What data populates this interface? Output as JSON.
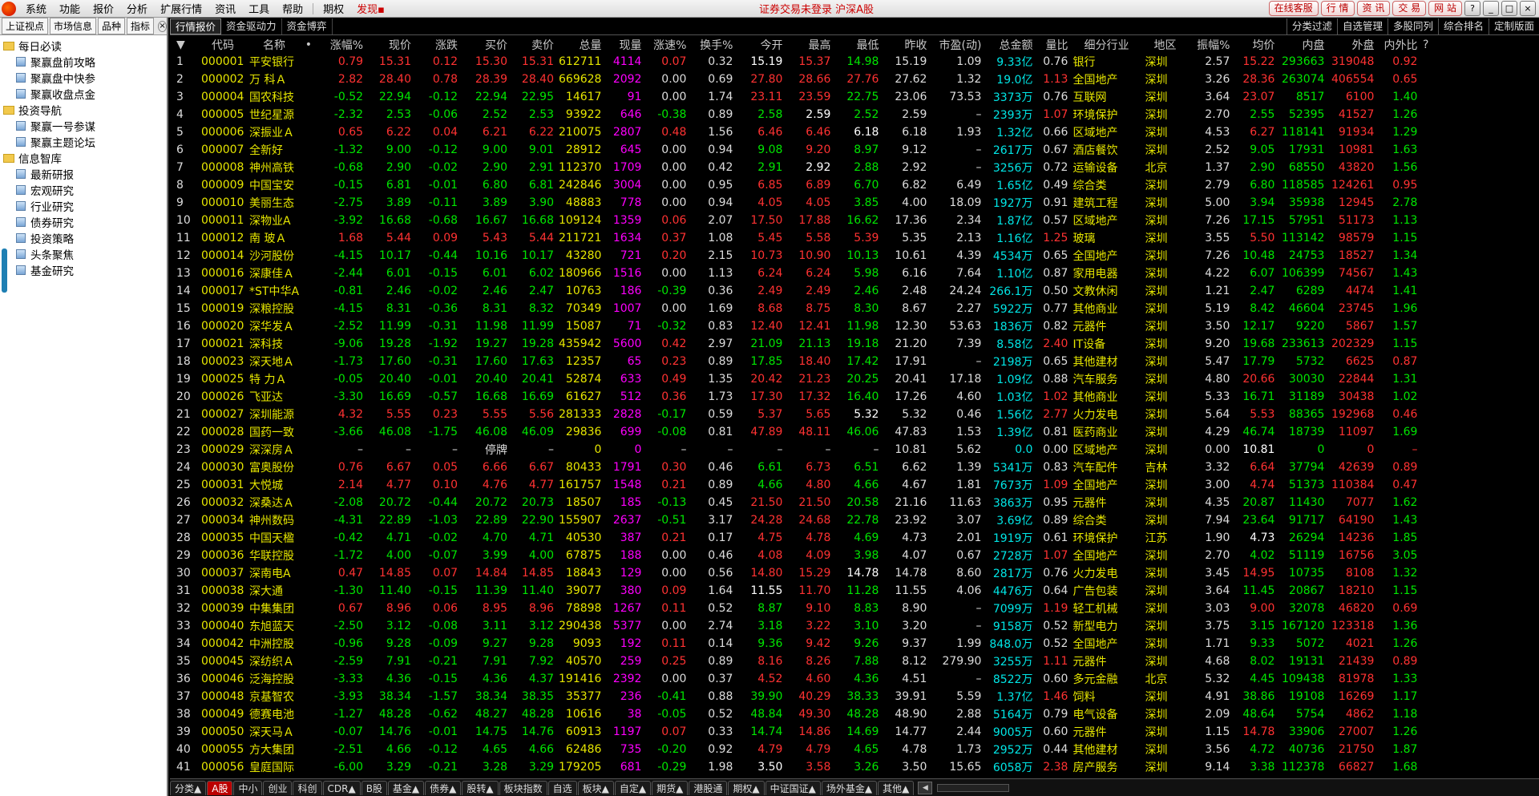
{
  "menubar": {
    "items": [
      "系统",
      "功能",
      "报价",
      "分析",
      "扩展行情",
      "资讯",
      "工具",
      "帮助"
    ],
    "extra_items": [
      "期权",
      "发现"
    ],
    "center_text": "证券交易未登录  沪深A股",
    "right_buttons": [
      "在线客服",
      "行 情",
      "资 讯",
      "交 易",
      "网 站"
    ],
    "window_buttons": [
      "?",
      "_",
      "□",
      "×"
    ]
  },
  "sidebar": {
    "tabs": [
      "上证视点",
      "市场信息",
      "品种",
      "指标"
    ],
    "close": "×",
    "tree": [
      {
        "label": "每日必读",
        "children": [
          "聚赢盘前攻略",
          "聚赢盘中快参",
          "聚赢收盘点金"
        ]
      },
      {
        "label": "投资导航",
        "children": [
          "聚赢一号参谋",
          "聚赢主题论坛"
        ]
      },
      {
        "label": "信息智库",
        "children": [
          "最新研报",
          "宏观研究",
          "行业研究",
          "债券研究",
          "投资策略",
          "头条聚焦",
          "基金研究"
        ]
      }
    ]
  },
  "toptabs": {
    "left": [
      "行情报价",
      "资金驱动力",
      "资金博弈"
    ],
    "right": [
      "分类过滤",
      "自选管理",
      "多股同列",
      "综合排名",
      "定制版面"
    ]
  },
  "table": {
    "headers": [
      "",
      "代码",
      "名称",
      "",
      "涨幅%",
      "现价",
      "涨跌",
      "买价",
      "卖价",
      "总量",
      "现量",
      "涨速%",
      "换手%",
      "今开",
      "最高",
      "最低",
      "昨收",
      "市盈(动)",
      "总金额",
      "量比",
      "细分行业",
      "地区",
      "振幅%",
      "均价",
      "内盘",
      "外盘",
      "内外比",
      "?"
    ],
    "rows": [
      [
        "1",
        "000001",
        "平安银行",
        "0.79",
        "15.31",
        "0.12",
        "15.30",
        "15.31",
        "612711",
        "4114",
        "0.07",
        "0.32",
        "15.19",
        "15.37",
        "14.98",
        "15.19",
        "1.09",
        "9.33亿",
        "0.76",
        "银行",
        "深圳",
        "2.57",
        "15.22",
        "293663",
        "319048",
        "0.92"
      ],
      [
        "2",
        "000002",
        "万 科Ａ",
        "2.82",
        "28.40",
        "0.78",
        "28.39",
        "28.40",
        "669628",
        "2092",
        "0.00",
        "0.69",
        "27.80",
        "28.66",
        "27.76",
        "27.62",
        "1.32",
        "19.0亿",
        "1.13",
        "全国地产",
        "深圳",
        "3.26",
        "28.36",
        "263074",
        "406554",
        "0.65"
      ],
      [
        "3",
        "000004",
        "国农科技",
        "-0.52",
        "22.94",
        "-0.12",
        "22.94",
        "22.95",
        "14617",
        "91",
        "0.00",
        "1.74",
        "23.11",
        "23.59",
        "22.75",
        "23.06",
        "73.53",
        "3373万",
        "0.76",
        "互联网",
        "深圳",
        "3.64",
        "23.07",
        "8517",
        "6100",
        "1.40"
      ],
      [
        "4",
        "000005",
        "世纪星源",
        "-2.32",
        "2.53",
        "-0.06",
        "2.52",
        "2.53",
        "93922",
        "646",
        "-0.38",
        "0.89",
        "2.58",
        "2.59",
        "2.52",
        "2.59",
        "–",
        "2393万",
        "1.07",
        "环境保护",
        "深圳",
        "2.70",
        "2.55",
        "52395",
        "41527",
        "1.26"
      ],
      [
        "5",
        "000006",
        "深振业Ａ",
        "0.65",
        "6.22",
        "0.04",
        "6.21",
        "6.22",
        "210075",
        "2807",
        "0.48",
        "1.56",
        "6.46",
        "6.46",
        "6.18",
        "6.18",
        "1.93",
        "1.32亿",
        "0.66",
        "区域地产",
        "深圳",
        "4.53",
        "6.27",
        "118141",
        "91934",
        "1.29"
      ],
      [
        "6",
        "000007",
        "全新好",
        "-1.32",
        "9.00",
        "-0.12",
        "9.00",
        "9.01",
        "28912",
        "645",
        "0.00",
        "0.94",
        "9.08",
        "9.20",
        "8.97",
        "9.12",
        "–",
        "2617万",
        "0.67",
        "酒店餐饮",
        "深圳",
        "2.52",
        "9.05",
        "17931",
        "10981",
        "1.63"
      ],
      [
        "7",
        "000008",
        "神州高铁",
        "-0.68",
        "2.90",
        "-0.02",
        "2.90",
        "2.91",
        "112370",
        "1709",
        "0.00",
        "0.42",
        "2.91",
        "2.92",
        "2.88",
        "2.92",
        "–",
        "3256万",
        "0.72",
        "运输设备",
        "北京",
        "1.37",
        "2.90",
        "68550",
        "43820",
        "1.56"
      ],
      [
        "8",
        "000009",
        "中国宝安",
        "-0.15",
        "6.81",
        "-0.01",
        "6.80",
        "6.81",
        "242846",
        "3004",
        "0.00",
        "0.95",
        "6.85",
        "6.89",
        "6.70",
        "6.82",
        "6.49",
        "1.65亿",
        "0.49",
        "综合类",
        "深圳",
        "2.79",
        "6.80",
        "118585",
        "124261",
        "0.95"
      ],
      [
        "9",
        "000010",
        "美丽生态",
        "-2.75",
        "3.89",
        "-0.11",
        "3.89",
        "3.90",
        "48883",
        "778",
        "0.00",
        "0.94",
        "4.05",
        "4.05",
        "3.85",
        "4.00",
        "18.09",
        "1927万",
        "0.91",
        "建筑工程",
        "深圳",
        "5.00",
        "3.94",
        "35938",
        "12945",
        "2.78"
      ],
      [
        "10",
        "000011",
        "深物业A",
        "-3.92",
        "16.68",
        "-0.68",
        "16.67",
        "16.68",
        "109124",
        "1359",
        "0.06",
        "2.07",
        "17.50",
        "17.88",
        "16.62",
        "17.36",
        "2.34",
        "1.87亿",
        "0.57",
        "区域地产",
        "深圳",
        "7.26",
        "17.15",
        "57951",
        "51173",
        "1.13"
      ],
      [
        "11",
        "000012",
        "南 玻Ａ",
        "1.68",
        "5.44",
        "0.09",
        "5.43",
        "5.44",
        "211721",
        "1634",
        "0.37",
        "1.08",
        "5.45",
        "5.58",
        "5.39",
        "5.35",
        "2.13",
        "1.16亿",
        "1.25",
        "玻璃",
        "深圳",
        "3.55",
        "5.50",
        "113142",
        "98579",
        "1.15"
      ],
      [
        "12",
        "000014",
        "沙河股份",
        "-4.15",
        "10.17",
        "-0.44",
        "10.16",
        "10.17",
        "43280",
        "721",
        "0.20",
        "2.15",
        "10.73",
        "10.90",
        "10.13",
        "10.61",
        "4.39",
        "4534万",
        "0.65",
        "全国地产",
        "深圳",
        "7.26",
        "10.48",
        "24753",
        "18527",
        "1.34"
      ],
      [
        "13",
        "000016",
        "深康佳Ａ",
        "-2.44",
        "6.01",
        "-0.15",
        "6.01",
        "6.02",
        "180966",
        "1516",
        "0.00",
        "1.13",
        "6.24",
        "6.24",
        "5.98",
        "6.16",
        "7.64",
        "1.10亿",
        "0.87",
        "家用电器",
        "深圳",
        "4.22",
        "6.07",
        "106399",
        "74567",
        "1.43"
      ],
      [
        "14",
        "000017",
        "*ST中华A",
        "-0.81",
        "2.46",
        "-0.02",
        "2.46",
        "2.47",
        "10763",
        "186",
        "-0.39",
        "0.36",
        "2.49",
        "2.49",
        "2.46",
        "2.48",
        "24.24",
        "266.1万",
        "0.50",
        "文教休闲",
        "深圳",
        "1.21",
        "2.47",
        "6289",
        "4474",
        "1.41"
      ],
      [
        "15",
        "000019",
        "深粮控股",
        "-4.15",
        "8.31",
        "-0.36",
        "8.31",
        "8.32",
        "70349",
        "1007",
        "0.00",
        "1.69",
        "8.68",
        "8.75",
        "8.30",
        "8.67",
        "2.27",
        "5922万",
        "0.77",
        "其他商业",
        "深圳",
        "5.19",
        "8.42",
        "46604",
        "23745",
        "1.96"
      ],
      [
        "16",
        "000020",
        "深华发Ａ",
        "-2.52",
        "11.99",
        "-0.31",
        "11.98",
        "11.99",
        "15087",
        "71",
        "-0.32",
        "0.83",
        "12.40",
        "12.41",
        "11.98",
        "12.30",
        "53.63",
        "1836万",
        "0.82",
        "元器件",
        "深圳",
        "3.50",
        "12.17",
        "9220",
        "5867",
        "1.57"
      ],
      [
        "17",
        "000021",
        "深科技",
        "-9.06",
        "19.28",
        "-1.92",
        "19.27",
        "19.28",
        "435942",
        "5600",
        "0.42",
        "2.97",
        "21.09",
        "21.13",
        "19.18",
        "21.20",
        "7.39",
        "8.58亿",
        "2.40",
        "IT设备",
        "深圳",
        "9.20",
        "19.68",
        "233613",
        "202329",
        "1.15"
      ],
      [
        "18",
        "000023",
        "深天地Ａ",
        "-1.73",
        "17.60",
        "-0.31",
        "17.60",
        "17.63",
        "12357",
        "65",
        "0.23",
        "0.89",
        "17.85",
        "18.40",
        "17.42",
        "17.91",
        "–",
        "2198万",
        "0.65",
        "其他建材",
        "深圳",
        "5.47",
        "17.79",
        "5732",
        "6625",
        "0.87"
      ],
      [
        "19",
        "000025",
        "特 力Ａ",
        "-0.05",
        "20.40",
        "-0.01",
        "20.40",
        "20.41",
        "52874",
        "633",
        "0.49",
        "1.35",
        "20.42",
        "21.23",
        "20.25",
        "20.41",
        "17.18",
        "1.09亿",
        "0.88",
        "汽车服务",
        "深圳",
        "4.80",
        "20.66",
        "30030",
        "22844",
        "1.31"
      ],
      [
        "20",
        "000026",
        "飞亚达",
        "-3.30",
        "16.69",
        "-0.57",
        "16.68",
        "16.69",
        "61627",
        "512",
        "0.36",
        "1.73",
        "17.30",
        "17.32",
        "16.40",
        "17.26",
        "4.60",
        "1.03亿",
        "1.02",
        "其他商业",
        "深圳",
        "5.33",
        "16.71",
        "31189",
        "30438",
        "1.02"
      ],
      [
        "21",
        "000027",
        "深圳能源",
        "4.32",
        "5.55",
        "0.23",
        "5.55",
        "5.56",
        "281333",
        "2828",
        "-0.17",
        "0.59",
        "5.37",
        "5.65",
        "5.32",
        "5.32",
        "0.46",
        "1.56亿",
        "2.77",
        "火力发电",
        "深圳",
        "5.64",
        "5.53",
        "88365",
        "192968",
        "0.46"
      ],
      [
        "22",
        "000028",
        "国药一致",
        "-3.66",
        "46.08",
        "-1.75",
        "46.08",
        "46.09",
        "29836",
        "699",
        "-0.08",
        "0.81",
        "47.89",
        "48.11",
        "46.06",
        "47.83",
        "1.53",
        "1.39亿",
        "0.81",
        "医药商业",
        "深圳",
        "4.29",
        "46.74",
        "18739",
        "11097",
        "1.69"
      ],
      [
        "23",
        "000029",
        "深深房Ａ",
        "–",
        "–",
        "–",
        "停牌",
        "–",
        "0",
        "0",
        "–",
        "–",
        "–",
        "–",
        "–",
        "10.81",
        "5.62",
        "0.0",
        "0.00",
        "区域地产",
        "深圳",
        "0.00",
        "10.81",
        "0",
        "0",
        "–"
      ],
      [
        "24",
        "000030",
        "富奥股份",
        "0.76",
        "6.67",
        "0.05",
        "6.66",
        "6.67",
        "80433",
        "1791",
        "0.30",
        "0.46",
        "6.61",
        "6.73",
        "6.51",
        "6.62",
        "1.39",
        "5341万",
        "0.83",
        "汽车配件",
        "吉林",
        "3.32",
        "6.64",
        "37794",
        "42639",
        "0.89"
      ],
      [
        "25",
        "000031",
        "大悦城",
        "2.14",
        "4.77",
        "0.10",
        "4.76",
        "4.77",
        "161757",
        "1548",
        "0.21",
        "0.89",
        "4.66",
        "4.80",
        "4.66",
        "4.67",
        "1.81",
        "7673万",
        "1.09",
        "全国地产",
        "深圳",
        "3.00",
        "4.74",
        "51373",
        "110384",
        "0.47"
      ],
      [
        "26",
        "000032",
        "深桑达Ａ",
        "-2.08",
        "20.72",
        "-0.44",
        "20.72",
        "20.73",
        "18507",
        "185",
        "-0.13",
        "0.45",
        "21.50",
        "21.50",
        "20.58",
        "21.16",
        "11.63",
        "3863万",
        "0.95",
        "元器件",
        "深圳",
        "4.35",
        "20.87",
        "11430",
        "7077",
        "1.62"
      ],
      [
        "27",
        "000034",
        "神州数码",
        "-4.31",
        "22.89",
        "-1.03",
        "22.89",
        "22.90",
        "155907",
        "2637",
        "-0.51",
        "3.17",
        "24.28",
        "24.68",
        "22.78",
        "23.92",
        "3.07",
        "3.69亿",
        "0.89",
        "综合类",
        "深圳",
        "7.94",
        "23.64",
        "91717",
        "64190",
        "1.43"
      ],
      [
        "28",
        "000035",
        "中国天楹",
        "-0.42",
        "4.71",
        "-0.02",
        "4.70",
        "4.71",
        "40530",
        "387",
        "0.21",
        "0.17",
        "4.75",
        "4.78",
        "4.69",
        "4.73",
        "2.01",
        "1919万",
        "0.61",
        "环境保护",
        "江苏",
        "1.90",
        "4.73",
        "26294",
        "14236",
        "1.85"
      ],
      [
        "29",
        "000036",
        "华联控股",
        "-1.72",
        "4.00",
        "-0.07",
        "3.99",
        "4.00",
        "67875",
        "188",
        "0.00",
        "0.46",
        "4.08",
        "4.09",
        "3.98",
        "4.07",
        "0.67",
        "2728万",
        "1.07",
        "全国地产",
        "深圳",
        "2.70",
        "4.02",
        "51119",
        "16756",
        "3.05"
      ],
      [
        "30",
        "000037",
        "深南电A",
        "0.47",
        "14.85",
        "0.07",
        "14.84",
        "14.85",
        "18843",
        "129",
        "0.00",
        "0.56",
        "14.80",
        "15.29",
        "14.78",
        "14.78",
        "8.60",
        "2817万",
        "0.76",
        "火力发电",
        "深圳",
        "3.45",
        "14.95",
        "10735",
        "8108",
        "1.32"
      ],
      [
        "31",
        "000038",
        "深大通",
        "-1.30",
        "11.40",
        "-0.15",
        "11.39",
        "11.40",
        "39077",
        "380",
        "0.09",
        "1.64",
        "11.55",
        "11.70",
        "11.28",
        "11.55",
        "4.06",
        "4476万",
        "0.64",
        "广告包装",
        "深圳",
        "3.64",
        "11.45",
        "20867",
        "18210",
        "1.15"
      ],
      [
        "32",
        "000039",
        "中集集团",
        "0.67",
        "8.96",
        "0.06",
        "8.95",
        "8.96",
        "78898",
        "1267",
        "0.11",
        "0.52",
        "8.87",
        "9.10",
        "8.83",
        "8.90",
        "–",
        "7099万",
        "1.19",
        "轻工机械",
        "深圳",
        "3.03",
        "9.00",
        "32078",
        "46820",
        "0.69"
      ],
      [
        "33",
        "000040",
        "东旭蓝天",
        "-2.50",
        "3.12",
        "-0.08",
        "3.11",
        "3.12",
        "290438",
        "5377",
        "0.00",
        "2.74",
        "3.18",
        "3.22",
        "3.10",
        "3.20",
        "–",
        "9158万",
        "0.52",
        "新型电力",
        "深圳",
        "3.75",
        "3.15",
        "167120",
        "123318",
        "1.36"
      ],
      [
        "34",
        "000042",
        "中洲控股",
        "-0.96",
        "9.28",
        "-0.09",
        "9.27",
        "9.28",
        "9093",
        "192",
        "0.11",
        "0.14",
        "9.36",
        "9.42",
        "9.26",
        "9.37",
        "1.99",
        "848.0万",
        "0.52",
        "全国地产",
        "深圳",
        "1.71",
        "9.33",
        "5072",
        "4021",
        "1.26"
      ],
      [
        "35",
        "000045",
        "深纺织Ａ",
        "-2.59",
        "7.91",
        "-0.21",
        "7.91",
        "7.92",
        "40570",
        "259",
        "0.25",
        "0.89",
        "8.16",
        "8.26",
        "7.88",
        "8.12",
        "279.90",
        "3255万",
        "1.11",
        "元器件",
        "深圳",
        "4.68",
        "8.02",
        "19131",
        "21439",
        "0.89"
      ],
      [
        "36",
        "000046",
        "泛海控股",
        "-3.33",
        "4.36",
        "-0.15",
        "4.36",
        "4.37",
        "191416",
        "2392",
        "0.00",
        "0.37",
        "4.52",
        "4.60",
        "4.36",
        "4.51",
        "–",
        "8522万",
        "0.60",
        "多元金融",
        "北京",
        "5.32",
        "4.45",
        "109438",
        "81978",
        "1.33"
      ],
      [
        "37",
        "000048",
        "京基智农",
        "-3.93",
        "38.34",
        "-1.57",
        "38.34",
        "38.35",
        "35377",
        "236",
        "-0.41",
        "0.88",
        "39.90",
        "40.29",
        "38.33",
        "39.91",
        "5.59",
        "1.37亿",
        "1.46",
        "饲料",
        "深圳",
        "4.91",
        "38.86",
        "19108",
        "16269",
        "1.17"
      ],
      [
        "38",
        "000049",
        "德赛电池",
        "-1.27",
        "48.28",
        "-0.62",
        "48.27",
        "48.28",
        "10616",
        "38",
        "-0.05",
        "0.52",
        "48.84",
        "49.30",
        "48.28",
        "48.90",
        "2.88",
        "5164万",
        "0.79",
        "电气设备",
        "深圳",
        "2.09",
        "48.64",
        "5754",
        "4862",
        "1.18"
      ],
      [
        "39",
        "000050",
        "深天马Ａ",
        "-0.07",
        "14.76",
        "-0.01",
        "14.75",
        "14.76",
        "60913",
        "1197",
        "0.07",
        "0.33",
        "14.74",
        "14.86",
        "14.69",
        "14.77",
        "2.44",
        "9005万",
        "0.60",
        "元器件",
        "深圳",
        "1.15",
        "14.78",
        "33906",
        "27007",
        "1.26"
      ],
      [
        "40",
        "000055",
        "方大集团",
        "-2.51",
        "4.66",
        "-0.12",
        "4.65",
        "4.66",
        "62486",
        "735",
        "-0.20",
        "0.92",
        "4.79",
        "4.79",
        "4.65",
        "4.78",
        "1.73",
        "2952万",
        "0.44",
        "其他建材",
        "深圳",
        "3.56",
        "4.72",
        "40736",
        "21750",
        "1.87"
      ],
      [
        "41",
        "000056",
        "皇庭国际",
        "-6.00",
        "3.29",
        "-0.21",
        "3.28",
        "3.29",
        "179205",
        "681",
        "-0.29",
        "1.98",
        "3.50",
        "3.58",
        "3.26",
        "3.50",
        "15.65",
        "6058万",
        "2.38",
        "房产服务",
        "深圳",
        "9.14",
        "3.38",
        "112378",
        "66827",
        "1.68"
      ]
    ]
  },
  "bottombar": {
    "tabs": [
      "分类▲",
      "A股",
      "中小",
      "创业",
      "科创",
      "CDR▲",
      "B股",
      "基金▲",
      "债券▲",
      "股转▲",
      "板块指数",
      "自选",
      "板块▲",
      "自定▲",
      "期货▲",
      "港股通",
      "期权▲",
      "中证国证▲",
      "场外基金▲",
      "其他▲"
    ],
    "active": "A股"
  }
}
